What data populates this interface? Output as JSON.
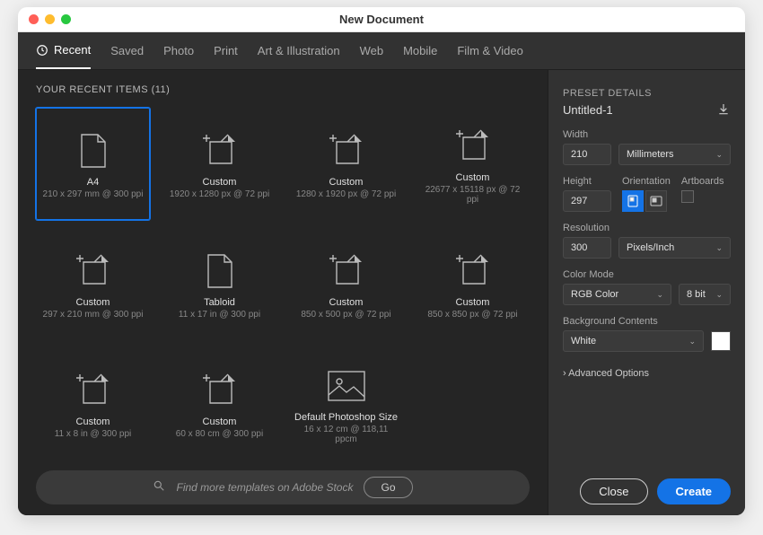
{
  "window": {
    "title": "New Document"
  },
  "tabs": [
    {
      "label": "Recent",
      "active": true,
      "icon": true
    },
    {
      "label": "Saved"
    },
    {
      "label": "Photo"
    },
    {
      "label": "Print"
    },
    {
      "label": "Art & Illustration"
    },
    {
      "label": "Web"
    },
    {
      "label": "Mobile"
    },
    {
      "label": "Film & Video"
    }
  ],
  "section_label": "YOUR RECENT ITEMS  (11)",
  "presets": [
    {
      "name": "A4",
      "dims": "210 x 297 mm @ 300 ppi",
      "icon": "doc",
      "selected": true
    },
    {
      "name": "Custom",
      "dims": "1920 x 1280 px @ 72 ppi",
      "icon": "clip"
    },
    {
      "name": "Custom",
      "dims": "1280 x 1920 px @ 72 ppi",
      "icon": "clip"
    },
    {
      "name": "Custom",
      "dims": "22677 x 15118 px @ 72 ppi",
      "icon": "clip"
    },
    {
      "name": "Custom",
      "dims": "297 x 210 mm @ 300 ppi",
      "icon": "clip"
    },
    {
      "name": "Tabloid",
      "dims": "11 x 17 in @ 300 ppi",
      "icon": "doc"
    },
    {
      "name": "Custom",
      "dims": "850 x 500 px @ 72 ppi",
      "icon": "clip"
    },
    {
      "name": "Custom",
      "dims": "850 x 850 px @ 72 ppi",
      "icon": "clip"
    },
    {
      "name": "Custom",
      "dims": "11 x 8 in @ 300 ppi",
      "icon": "clip"
    },
    {
      "name": "Custom",
      "dims": "60 x 80 cm @ 300 ppi",
      "icon": "clip"
    },
    {
      "name": "Default Photoshop Size",
      "dims": "16 x 12 cm @ 118,11 ppcm",
      "icon": "image"
    }
  ],
  "search": {
    "placeholder": "Find more templates on Adobe Stock",
    "go": "Go"
  },
  "details": {
    "heading": "PRESET DETAILS",
    "name": "Untitled-1",
    "width_label": "Width",
    "width": "210",
    "units": "Millimeters",
    "height_label": "Height",
    "height": "297",
    "orientation_label": "Orientation",
    "artboards_label": "Artboards",
    "resolution_label": "Resolution",
    "resolution": "300",
    "resolution_units": "Pixels/Inch",
    "color_label": "Color Mode",
    "color_mode": "RGB Color",
    "bit_depth": "8 bit",
    "bg_label": "Background Contents",
    "bg": "White",
    "advanced": "Advanced Options"
  },
  "buttons": {
    "close": "Close",
    "create": "Create"
  }
}
